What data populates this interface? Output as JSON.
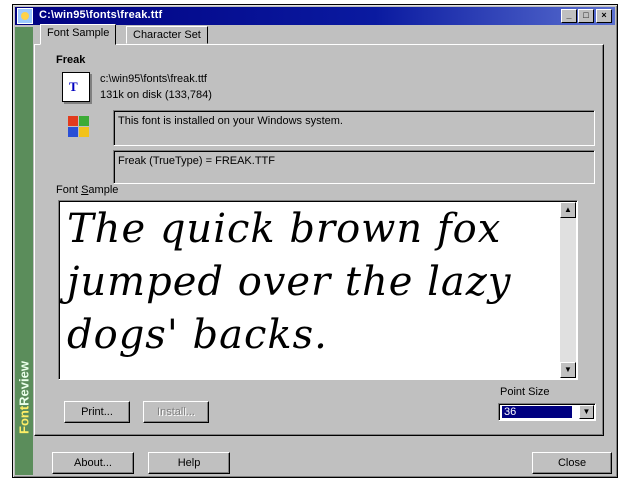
{
  "window": {
    "title": "C:\\win95\\fonts\\freak.ttf"
  },
  "title_buttons": {
    "minimize": "_",
    "maximize": "□",
    "close": "×"
  },
  "sidebar": {
    "brand_part1": "Font",
    "brand_part2": "Review"
  },
  "tabs": [
    {
      "label": "Font Sample",
      "active": true
    },
    {
      "label": "Character Set",
      "active": false
    }
  ],
  "font": {
    "name": "Freak",
    "icon_text": "T",
    "path": "c:\\win95\\fonts\\freak.ttf",
    "size": "131k on disk (133,784)",
    "install_status": "This font is installed on your Windows system.",
    "registry_entry": "Freak (TrueType) = FREAK.TTF"
  },
  "sample": {
    "label_prefix": "Font ",
    "label_accel": "S",
    "label_suffix": "ample",
    "text": "The quick brown fox jumped over the lazy dogs' backs."
  },
  "buttons": {
    "print": "Print...",
    "install": "Install...",
    "about": "About...",
    "help": "Help",
    "close": "Close"
  },
  "point_size": {
    "label": "Point Size",
    "value": "36"
  },
  "colors": {
    "titlebar": "#000080",
    "sidebar": "#5b8d5b",
    "face": "#c0c0c0"
  }
}
